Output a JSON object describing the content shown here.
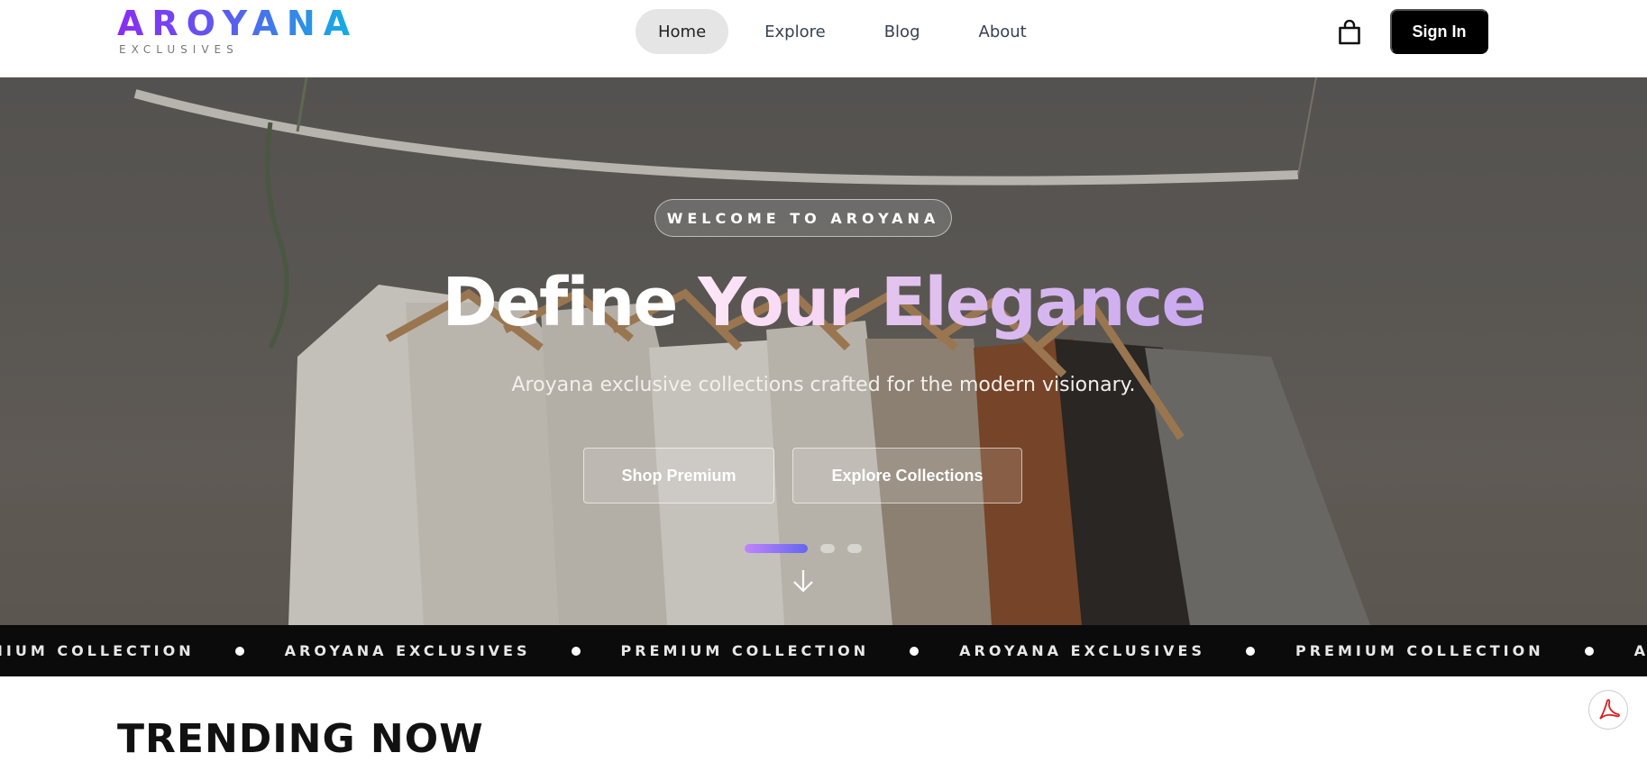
{
  "header": {
    "logo": {
      "name": "AROYANA",
      "tagline": "EXCLUSIVES"
    },
    "nav": [
      {
        "label": "Home",
        "active": true
      },
      {
        "label": "Explore",
        "active": false
      },
      {
        "label": "Blog",
        "active": false
      },
      {
        "label": "About",
        "active": false
      }
    ],
    "cart_icon": "shopping-bag-icon",
    "sign_in_label": "Sign In"
  },
  "hero": {
    "badge": "WELCOME TO AROYANA",
    "headline": {
      "word1": "Define",
      "word2": "Your",
      "word3": "Elegance"
    },
    "subtitle": "Aroyana exclusive collections crafted for the modern visionary.",
    "buttons": {
      "primary": "Shop Premium",
      "secondary": "Explore Collections"
    },
    "slides": {
      "count": 3,
      "active_index": 0
    },
    "scroll_icon": "arrow-down-icon"
  },
  "marquee": {
    "items": [
      "PREMIUM COLLECTION",
      "AROYANA EXCLUSIVES",
      "PREMIUM COLLECTION",
      "AROYANA EXCLUSIVES",
      "PREMIUM COLLECTION",
      "AROYANA EXCLUSIVES"
    ]
  },
  "section": {
    "title": "TRENDING NOW"
  },
  "floating": {
    "pdf_icon": "acrobat-pdf-icon"
  },
  "colors": {
    "accent_purple": "#8b2cf5",
    "accent_cyan": "#0fb3e0",
    "dark": "#0b0b0b"
  }
}
